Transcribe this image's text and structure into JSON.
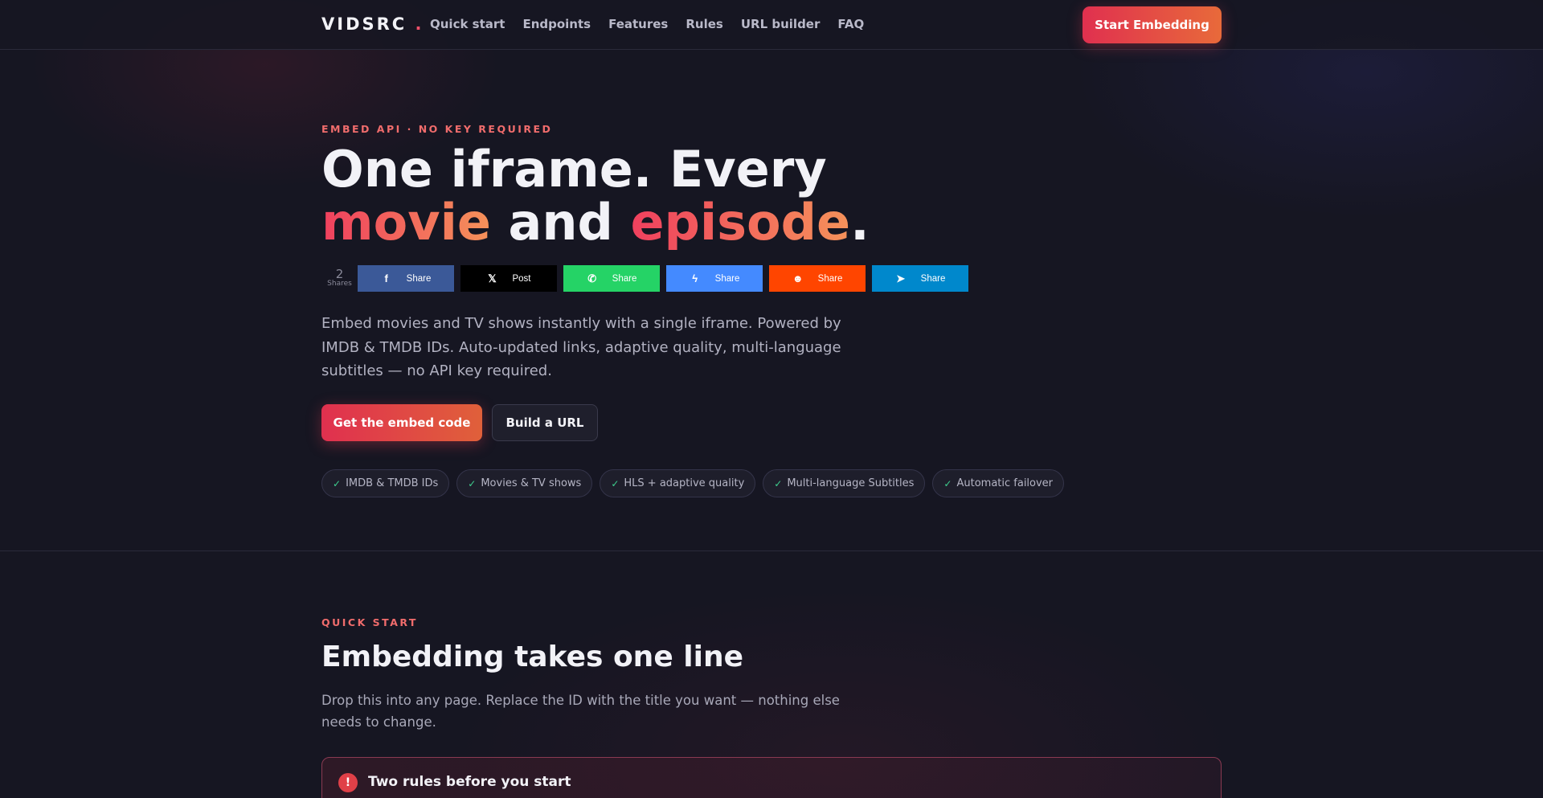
{
  "nav": {
    "logo": "VIDSRC",
    "logo_dot": ".",
    "links": [
      "Quick start",
      "Endpoints",
      "Features",
      "Rules",
      "URL builder",
      "FAQ"
    ],
    "cta": "Start Embedding"
  },
  "hero": {
    "eyebrow": "EMBED API · NO KEY REQUIRED",
    "title_line1": "One iframe. Every",
    "title_word_movie": "movie",
    "title_word_and": " and ",
    "title_word_episode": "episode",
    "title_period": ".",
    "description": "Embed movies and TV shows instantly with a single iframe. Powered by IMDB & TMDB IDs. Auto-updated links, adaptive quality, multi-language subtitles — no API key required.",
    "primary_button": "Get the embed code",
    "secondary_button": "Build a URL",
    "pills": [
      "IMDB & TMDB IDs",
      "Movies & TV shows",
      "HLS + adaptive quality",
      "Multi-language Subtitles",
      "Automatic failover"
    ],
    "pill_check": "✓"
  },
  "share": {
    "count": "2",
    "count_label": "Shares",
    "buttons": [
      {
        "network": "facebook",
        "icon": "f",
        "label": "Share",
        "color": "#3b5998"
      },
      {
        "network": "x",
        "icon": "𝕏",
        "label": "Post",
        "color": "#000000"
      },
      {
        "network": "whatsapp",
        "icon": "✆",
        "label": "Share",
        "color": "#25d366"
      },
      {
        "network": "messenger",
        "icon": "ϟ",
        "label": "Share",
        "color": "#448aff"
      },
      {
        "network": "reddit",
        "icon": "☻",
        "label": "Share",
        "color": "#ff4500"
      },
      {
        "network": "telegram",
        "icon": "➤",
        "label": "Share",
        "color": "#0088cc"
      }
    ]
  },
  "quick_start": {
    "eyebrow": "QUICK START",
    "title": "Embedding takes one line",
    "description": "Drop this into any page. Replace the ID with the title you want — nothing else needs to change.",
    "rules_icon": "!",
    "rules_title": "Two rules before you start"
  },
  "colors": {
    "accent_start": "#e0304f",
    "accent_end": "#e86a3a",
    "background": "#161622",
    "check": "#3ecf8e"
  }
}
